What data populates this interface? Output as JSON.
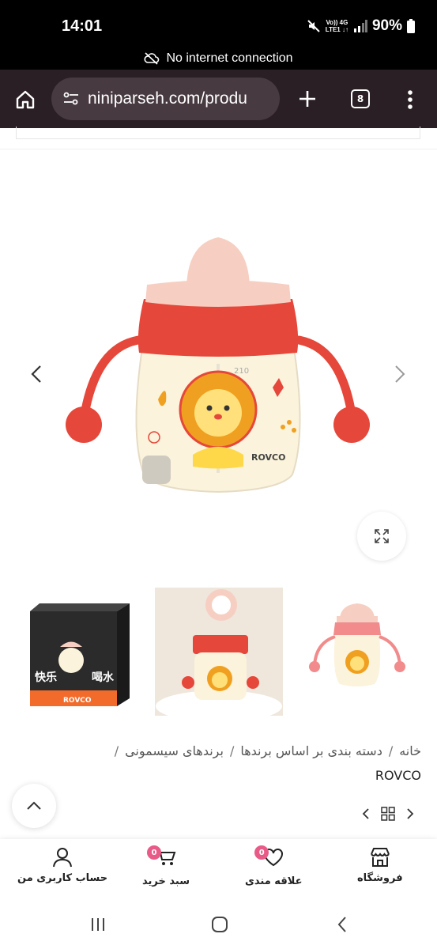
{
  "status": {
    "time": "14:01",
    "network_top": "Vo)) 4G",
    "network_bottom": "LTE1 ↓↑",
    "battery": "90%"
  },
  "connection": {
    "message": "No internet connection"
  },
  "browser": {
    "url": "niniparseh.com/produ",
    "tab_count": "8"
  },
  "breadcrumb": {
    "items": [
      "خانه",
      "دسته بندی بر اساس برندها",
      "برندهای سیسمونی"
    ],
    "separator": "/",
    "current": "ROVCO"
  },
  "product": {
    "brand_mark": "ROVCO",
    "cup_volume_mark": "210"
  },
  "thumbnails": {
    "box_text_1": "快乐",
    "box_text_2": "喝水",
    "box_brand": "ROVCO"
  },
  "bottom_nav": {
    "shop": "فروشگاه",
    "wishlist": "علاقه مندی",
    "wishlist_count": "0",
    "cart": "سبد خرید",
    "cart_count": "0",
    "account": "حساب کاربری من"
  },
  "colors": {
    "cup_red": "#e5473a",
    "cup_lid": "#f6cfc2",
    "badge": "#e85a87",
    "browser_bar": "#2a1f24"
  }
}
